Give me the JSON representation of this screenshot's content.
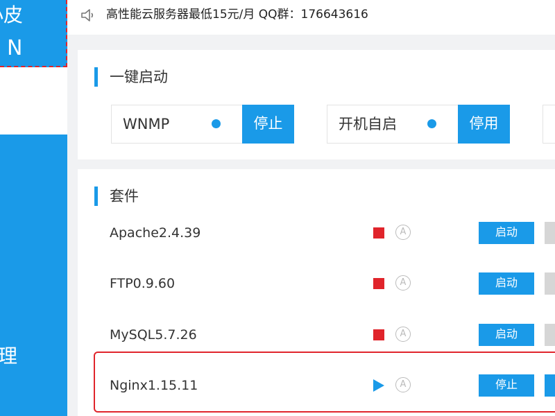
{
  "sidebar": {
    "logo_line1": "小皮",
    "logo_line2": "N",
    "nav_item": "管理"
  },
  "topbar": {
    "notice": "高性能云服务器最低15元/月  QQ群：176643616"
  },
  "quick_start": {
    "title": "一键启动",
    "switches": [
      {
        "label": "WNMP",
        "button": "停止"
      },
      {
        "label": "开机自启",
        "button": "停用"
      }
    ]
  },
  "suites": {
    "title": "套件",
    "auto_symbol": "A",
    "items": [
      {
        "name": "Apache2.4.39",
        "status": "stopped",
        "action": "启动"
      },
      {
        "name": "FTP0.9.60",
        "status": "stopped",
        "action": "启动"
      },
      {
        "name": "MySQL5.7.26",
        "status": "stopped",
        "action": "启动"
      },
      {
        "name": "Nginx1.15.11",
        "status": "running",
        "action": "停止"
      }
    ]
  },
  "colors": {
    "accent": "#1a9ae8",
    "stopped": "#e0242b",
    "highlight": "#e0242b"
  }
}
